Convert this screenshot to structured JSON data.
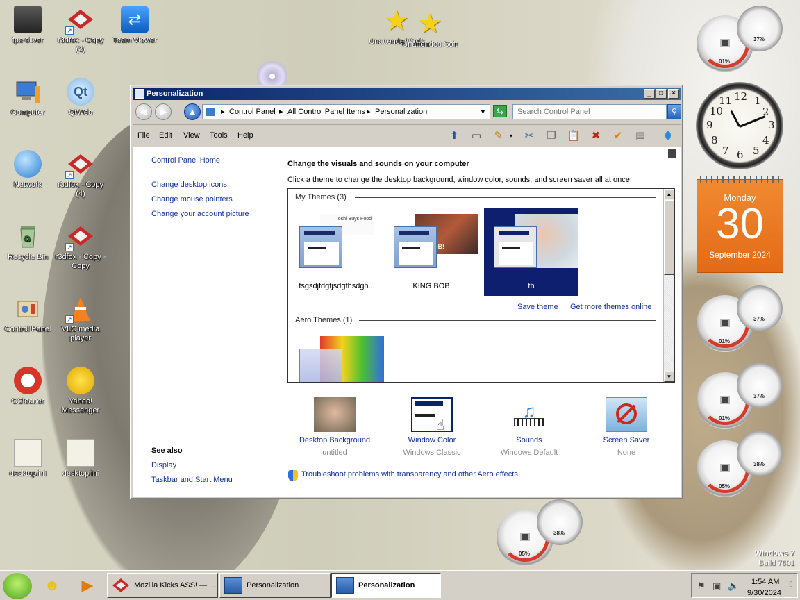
{
  "desktop": {
    "icons": [
      {
        "label": "fpe oliver"
      },
      {
        "label": "r3dfox - Copy (3)"
      },
      {
        "label": "Team Viewer"
      },
      {
        "label": "Computer"
      },
      {
        "label": "QtWeb"
      },
      {
        "label": "Network"
      },
      {
        "label": "r3dfox - Copy (4)"
      },
      {
        "label": "Recycle Bin"
      },
      {
        "label": "r3dfox - Copy - Copy"
      },
      {
        "label": "Control Panel"
      },
      {
        "label": "VLC media player"
      },
      {
        "label": "CCleaner"
      },
      {
        "label": "Yahoo! Messenger"
      },
      {
        "label": "desktop.ini"
      },
      {
        "label": "desktop.ini"
      },
      {
        "label": "Unattended Soft"
      },
      {
        "label": "Unattended Soft"
      }
    ],
    "watermark": {
      "line1": "Windows 7",
      "line2": "Build 7601"
    }
  },
  "gadgets": {
    "meters": [
      {
        "cpu": "01%",
        "mem": "37%"
      },
      {
        "cpu": "01%",
        "mem": "37%"
      },
      {
        "cpu": "01%",
        "mem": "37%"
      },
      {
        "cpu": "05%",
        "mem": "38%"
      },
      {
        "cpu": "05%",
        "mem": "38%"
      }
    ],
    "clock": {
      "numbers": [
        "12",
        "1",
        "2",
        "3",
        "4",
        "5",
        "6",
        "7",
        "8",
        "9",
        "10",
        "11"
      ]
    },
    "calendar": {
      "day": "Monday",
      "date": "30",
      "month_year": "September 2024"
    }
  },
  "window": {
    "title": "Personalization",
    "address": {
      "crumbs": [
        "Control Panel",
        "All Control Panel Items",
        "Personalization"
      ]
    },
    "search_placeholder": "Search Control Panel",
    "menu": [
      "File",
      "Edit",
      "View",
      "Tools",
      "Help"
    ],
    "left_nav": {
      "home": "Control Panel Home",
      "links": [
        "Change desktop icons",
        "Change mouse pointers",
        "Change your account picture"
      ],
      "see_also_title": "See also",
      "see_also": [
        "Display",
        "Taskbar and Start Menu"
      ]
    },
    "main": {
      "heading": "Change the visuals and sounds on your computer",
      "subheading": "Click a theme to change the desktop background, window color, sounds, and screen saver all at once.",
      "my_themes_header": "My Themes (3)",
      "my_themes": [
        {
          "name": "fsgsdjfdgfjsdgfhsdgh...",
          "thumb_text": "oshi Buys Food"
        },
        {
          "name": "KING BOB",
          "thumb_text": "NG BOB!"
        },
        {
          "name": "th",
          "thumb_text": ""
        }
      ],
      "save_theme": "Save theme",
      "get_more": "Get more themes online",
      "aero_header": "Aero Themes (1)",
      "customize": [
        {
          "label": "Desktop Background",
          "sub": "untitled"
        },
        {
          "label": "Window Color",
          "sub": "Windows Classic"
        },
        {
          "label": "Sounds",
          "sub": "Windows Default"
        },
        {
          "label": "Screen Saver",
          "sub": "None"
        }
      ],
      "troubleshoot": "Troubleshoot problems with transparency and other Aero effects"
    }
  },
  "taskbar": {
    "buttons": [
      {
        "label": "Mozilla Kicks ASS! — ..."
      },
      {
        "label": "Personalization"
      },
      {
        "label": "Personalization"
      }
    ],
    "clock_time": "1:54 AM",
    "clock_date": "9/30/2024"
  },
  "colors": {
    "selection": "#0d1f6e",
    "link": "#10319c",
    "titlebar": "#0a246a",
    "calendar": "#e36a17"
  }
}
